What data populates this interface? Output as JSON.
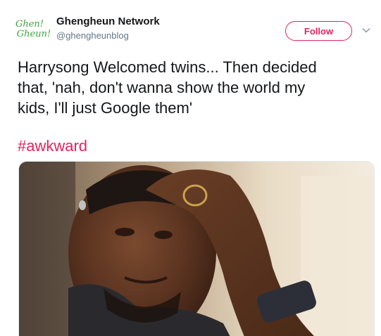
{
  "author": {
    "avatar_text_line1": "Ghen!",
    "avatar_text_line2": "Gheun!",
    "display_name": "Ghengheun Network",
    "handle": "@ghengheunblog"
  },
  "actions": {
    "follow_label": "Follow",
    "more_icon": "chevron-down-icon"
  },
  "tweet": {
    "text_lines": [
      "Harrysong Welcomed twins... Then decided",
      "that, 'nah, don't wanna show the world my",
      "kids, I'll just Google them'"
    ],
    "hashtag": "#awkward"
  },
  "media": {
    "type": "photo",
    "description_icon": "photo"
  },
  "colors": {
    "accent": "#e0245e",
    "text": "#14171a",
    "secondary": "#657786",
    "avatar_green": "#3fa73c"
  }
}
